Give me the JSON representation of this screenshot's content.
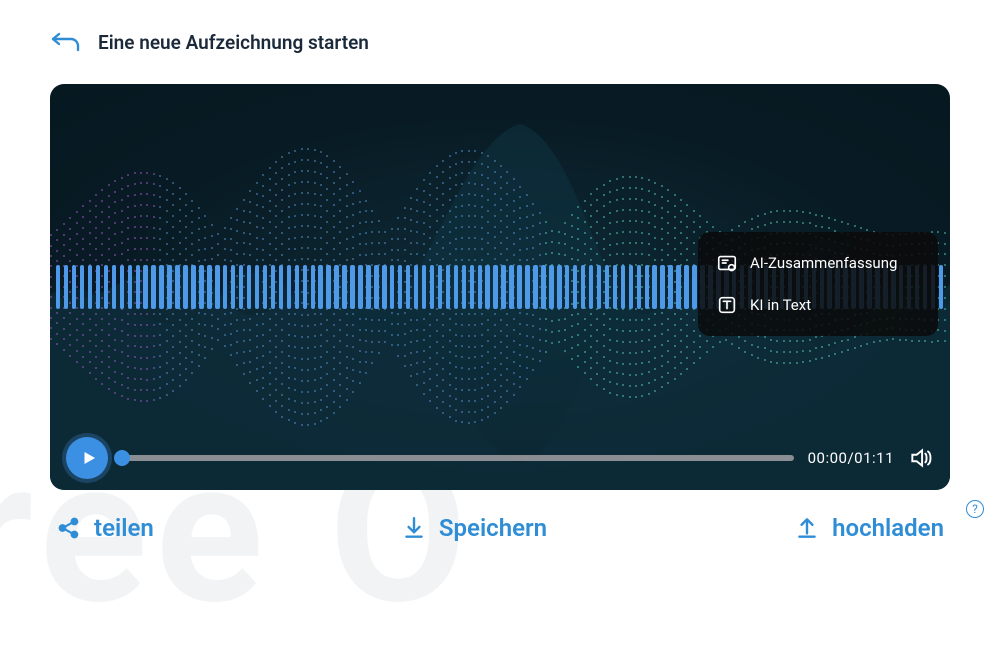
{
  "header": {
    "title": "Eine neue Aufzeichnung starten"
  },
  "menu": {
    "ai_summary": "AI-Zusammenfassung",
    "ki_text": "KI in Text"
  },
  "controls": {
    "time_current": "00:00",
    "time_total": "01:11"
  },
  "actions": {
    "share": "teilen",
    "save": "Speichern",
    "upload": "hochladen",
    "help_glyph": "?"
  },
  "colors": {
    "accent": "#2f8dd6",
    "player_bg": "#081b24",
    "bar": "#4f99e9"
  }
}
